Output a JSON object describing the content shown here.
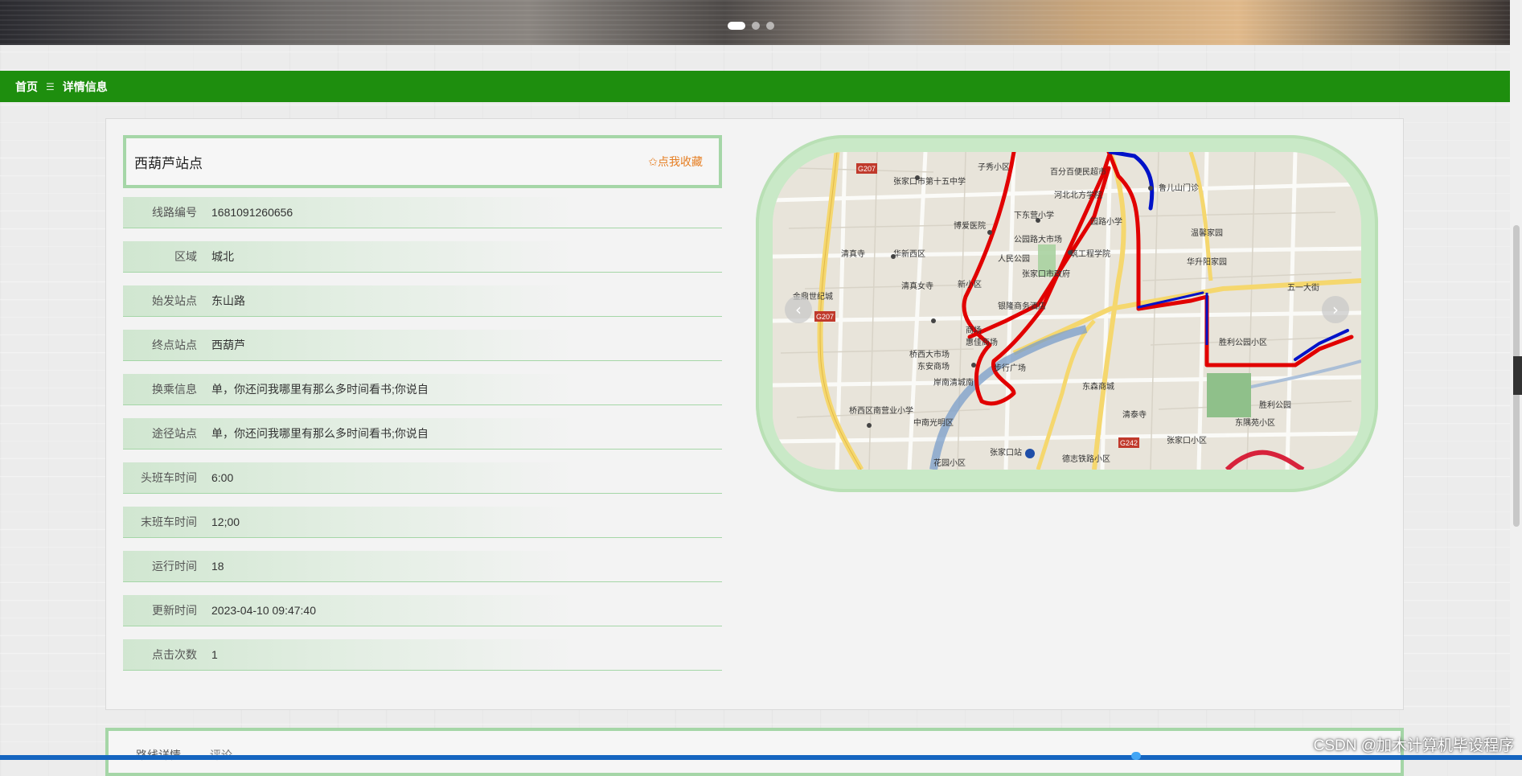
{
  "banner": {
    "slide_count": 3,
    "active_slide": 1
  },
  "breadcrumb": {
    "home": "首页",
    "separator": "☰",
    "current": "详情信息"
  },
  "detail": {
    "title": "西葫芦站点",
    "favorite_label": "✩点我收藏",
    "fields": [
      {
        "label": "线路编号",
        "value": "1681091260656"
      },
      {
        "label": "区域",
        "value": "城北"
      },
      {
        "label": "始发站点",
        "value": "东山路"
      },
      {
        "label": "终点站点",
        "value": "西葫芦"
      },
      {
        "label": "换乘信息",
        "value": "单，你还问我哪里有那么多时间看书;你说自"
      },
      {
        "label": "途径站点",
        "value": "单，你还问我哪里有那么多时间看书;你说自"
      },
      {
        "label": "头班车时间",
        "value": "6:00"
      },
      {
        "label": "末班车时间",
        "value": "12;00"
      },
      {
        "label": "运行时间",
        "value": "18"
      },
      {
        "label": "更新时间",
        "value": "2023-04-10 09:47:40"
      },
      {
        "label": "点击次数",
        "value": "1"
      }
    ]
  },
  "carousel": {
    "prev_icon": "chevron-left-icon",
    "next_icon": "chevron-right-icon",
    "prev": "‹",
    "next": "›"
  },
  "map_labels": {
    "l1": "子秀小区",
    "l2": "张家口市第十五中学",
    "l3": "百分百便民超市",
    "l4": "鲁儿山门诊",
    "l5": "河北北方学院",
    "l6": "下东营小学",
    "l7": "博爱医院",
    "l8": "园路小学",
    "l9": "温馨家园",
    "l10": "公园路大市场",
    "l11": "人民公园",
    "l12": "筑工程学院",
    "l13": "清真寺",
    "l14": "华新西区",
    "l15": "华升阳家园",
    "l16": "张家口市政府",
    "l17": "清真女寺",
    "l18": "新小区",
    "l19": "五一大街",
    "l20": "金鼎世纪城",
    "l21": "银隆商务酒店",
    "l22": "商场",
    "l23": "胜利公园小区",
    "l24": "惠佳商场",
    "l25": "桥西大市场",
    "l26": "东安商场",
    "l27": "步行广场",
    "l28": "东森商城",
    "l29": "岸南清城南",
    "l30": "胜利公园",
    "l31": "清泰寺",
    "l32": "中南光明区",
    "l33": "桥西区南营业小学",
    "l34": "东隅苑小区",
    "l35": "张家口站",
    "l36": "花园小区",
    "l37": "德志铁路小区",
    "l38": "张家口小区",
    "r1": "G207",
    "r2": "G207",
    "r3": "G242"
  },
  "route_detail": {
    "label": "路线详情",
    "value": "评论"
  },
  "watermark": "CSDN @加木计算机毕设程序",
  "colors": {
    "nav_green": "#1e8e0e",
    "border_green": "#a5d6a7",
    "favorite_orange": "#e67e22",
    "route_red": "#e10000",
    "route_blue": "#0012c8"
  }
}
